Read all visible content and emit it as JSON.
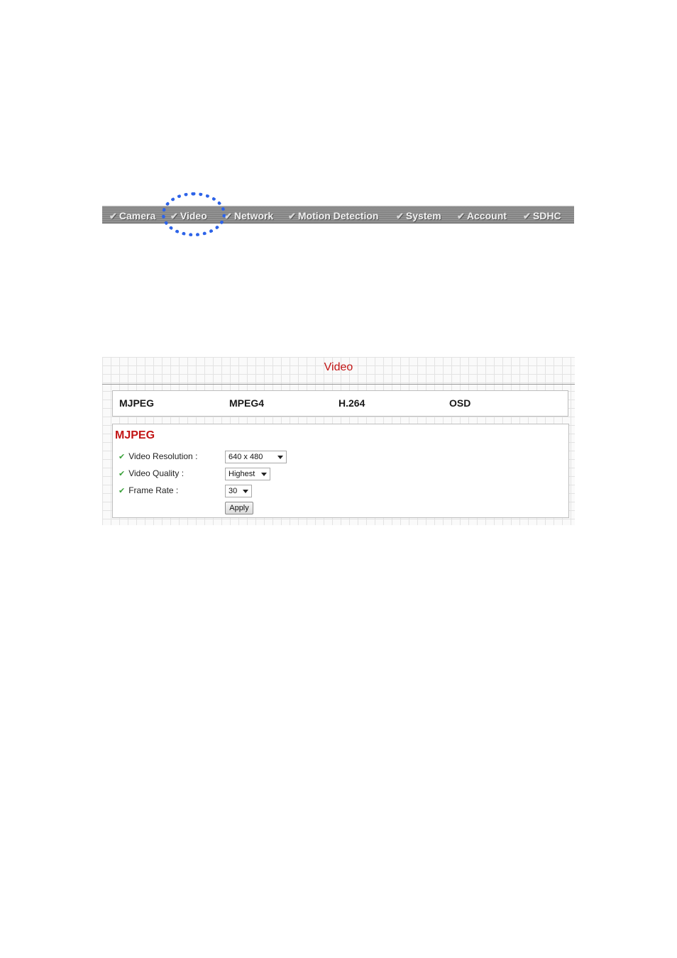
{
  "nav": {
    "items": [
      {
        "label": "Camera"
      },
      {
        "label": "Video"
      },
      {
        "label": "Network"
      },
      {
        "label": "Motion Detection"
      },
      {
        "label": "System"
      },
      {
        "label": "Account"
      },
      {
        "label": "SDHC"
      }
    ],
    "highlighted": "Video",
    "highlight_color": "#2d63e8"
  },
  "panel": {
    "title": "Video",
    "tabs": [
      {
        "label": "MJPEG"
      },
      {
        "label": "MPEG4"
      },
      {
        "label": "H.264"
      },
      {
        "label": "OSD"
      }
    ],
    "section_title": "MJPEG",
    "fields": [
      {
        "label": "Video Resolution :",
        "value": "640 x 480"
      },
      {
        "label": "Video Quality :",
        "value": "Highest"
      },
      {
        "label": "Frame Rate :",
        "value": "30"
      }
    ],
    "apply_label": "Apply",
    "accent_color": "#c21515"
  }
}
